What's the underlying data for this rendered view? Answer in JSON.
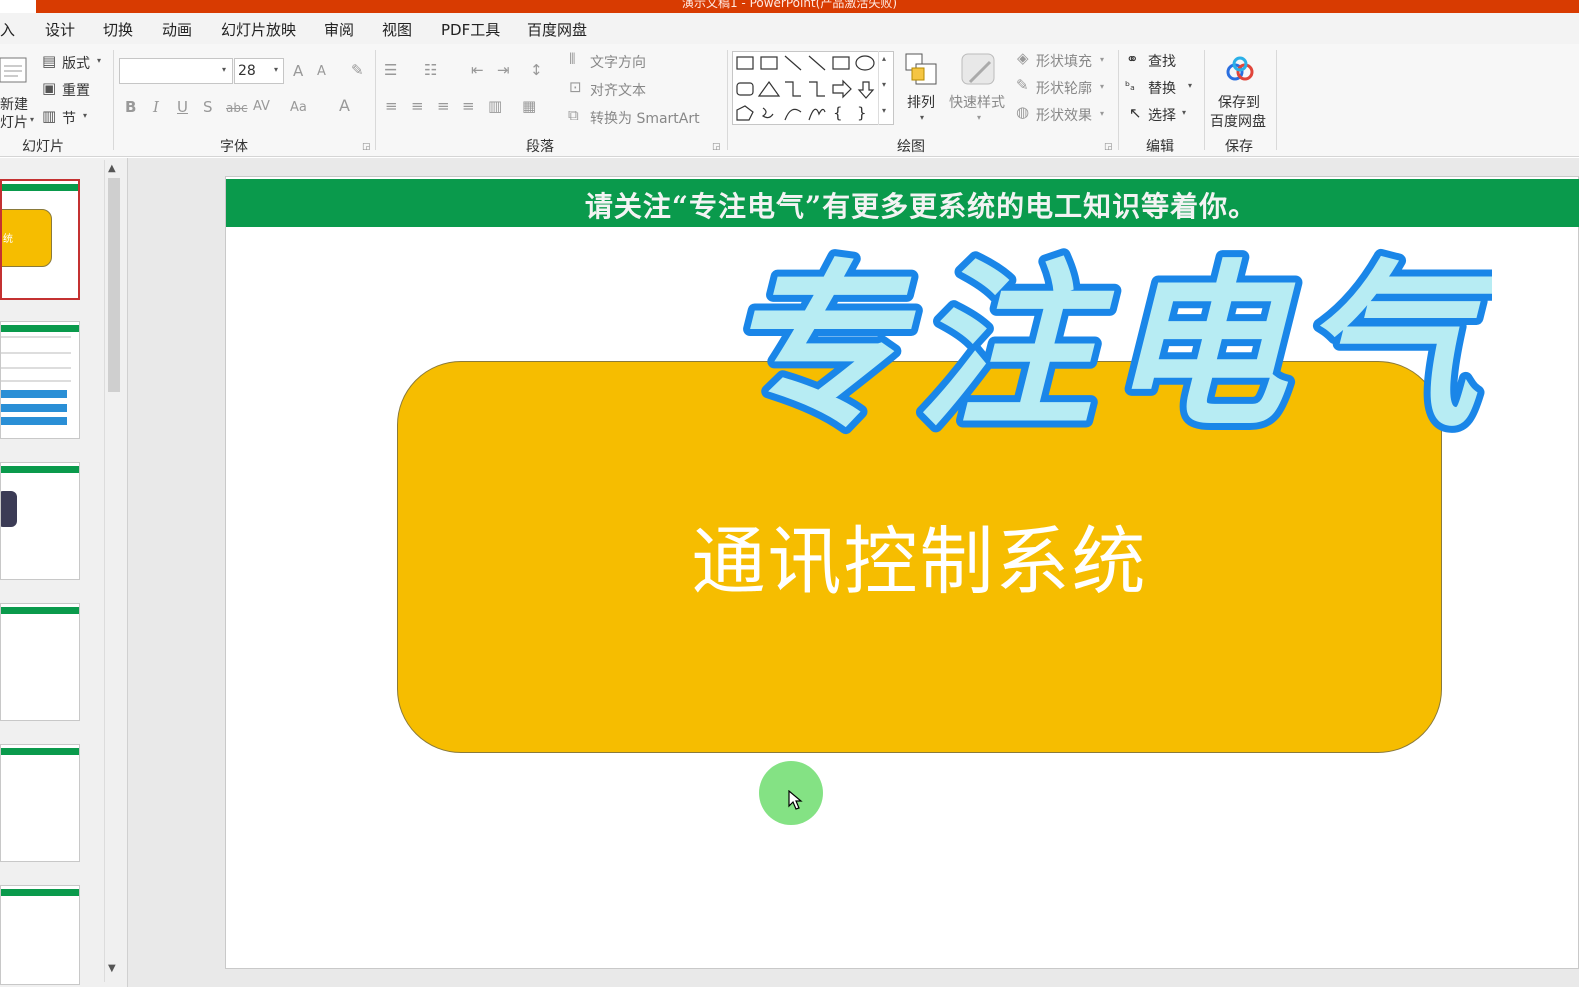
{
  "window": {
    "title": "演示文稿1 - PowerPoint(产品激活失败)"
  },
  "tabs": [
    {
      "label": "入"
    },
    {
      "label": "设计"
    },
    {
      "label": "切换"
    },
    {
      "label": "动画"
    },
    {
      "label": "幻灯片放映"
    },
    {
      "label": "审阅"
    },
    {
      "label": "视图"
    },
    {
      "label": "PDF工具"
    },
    {
      "label": "百度网盘"
    }
  ],
  "ribbon": {
    "slides": {
      "new_line1": "新建",
      "new_line2": "灯片",
      "layout": "版式",
      "reset": "重置",
      "section": "节",
      "label": "幻灯片"
    },
    "font": {
      "size": "28",
      "label": "字体",
      "grow": "A",
      "shrink": "A",
      "bold": "B",
      "italic": "I",
      "underline": "U",
      "shadow": "S",
      "strike": "abc",
      "spacing": "AV",
      "case": "Aa",
      "color": "A"
    },
    "paragraph": {
      "text_direction": "文字方向",
      "align_text": "对齐文本",
      "smartart": "转换为 SmartArt",
      "label": "段落"
    },
    "drawing": {
      "arrange": "排列",
      "quick_styles": "快速样式",
      "fill": "形状填充",
      "outline": "形状轮廓",
      "effects": "形状效果",
      "label": "绘图"
    },
    "editing": {
      "find": "查找",
      "replace": "替换",
      "select": "选择",
      "label": "编辑"
    },
    "save": {
      "line1": "保存到",
      "line2": "百度网盘",
      "label": "保存"
    }
  },
  "slide": {
    "banner": "请关注“专注电气”有更多更系统的电工知识等着你。",
    "logo_text": "专注电气",
    "title": "通讯控制系统"
  },
  "colors": {
    "accent_green": "#0a9a4c",
    "gold": "#f6bd00",
    "logo_fill": "#b7ecf3",
    "logo_stroke": "#1a86e8",
    "titlebar": "#d83b01"
  }
}
